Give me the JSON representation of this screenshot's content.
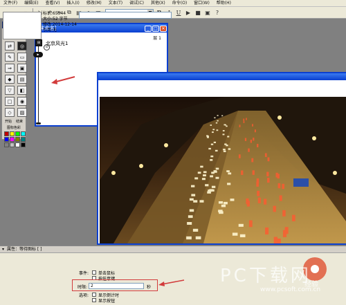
{
  "menu": [
    "文件(F)",
    "编辑(E)",
    "查看(V)",
    "插入(I)",
    "修改(M)",
    "文本(T)",
    "调试(C)",
    "其他(X)",
    "命令(O)",
    "窗口(W)",
    "帮助(H)"
  ],
  "toolbar": {
    "icons": [
      "new-icon",
      "open-icon",
      "save-icon",
      "import-icon",
      "undo-icon",
      "cut-icon",
      "copy-icon",
      "paste-icon",
      "find-icon",
      "text-style-icon"
    ],
    "bold_label": "B",
    "italic_label": "I",
    "underline_label": "U"
  },
  "palette": {
    "title": "图标",
    "icon_glyphs": [
      "⊞",
      "?",
      "⇄",
      "◎",
      "✎",
      "▭",
      "⇒",
      "▣",
      "◆",
      "▤",
      "▽",
      "◧",
      "□",
      "◉",
      "◇",
      "▨"
    ],
    "start_label": "开始",
    "end_label": "结束",
    "color_label": "图标色彩",
    "colors": [
      "#c00000",
      "#ffff00",
      "#00ff00",
      "#00ffff",
      "#0000ff",
      "#ff00ff",
      "#808000",
      "#008080",
      "#808080",
      "#c0c0c0",
      "#ffffff",
      "#000000"
    ]
  },
  "flow_window": {
    "title": "[未命名]",
    "level": "层 1",
    "icon_label": "北京风光1",
    "icon_glyph": "⊞",
    "hand_label": "▶"
  },
  "properties": {
    "title": "属性：等待图标 [ ]",
    "info": [
      "标识:65544",
      "大小:52 字节",
      "修改:2014-12-14",
      "引用:无"
    ],
    "event_label": "事件:",
    "event_options": [
      "单击鼠标",
      "按任意键"
    ],
    "time_label": "时限:",
    "time_value": "2",
    "time_unit": "秒",
    "options_label": "选项:",
    "option_items": [
      "显示倒计时",
      "显示按钮"
    ]
  },
  "watermark": {
    "main": "PC下载网",
    "url": "www.pcsoft.com.cn",
    "overlay": "经验"
  }
}
